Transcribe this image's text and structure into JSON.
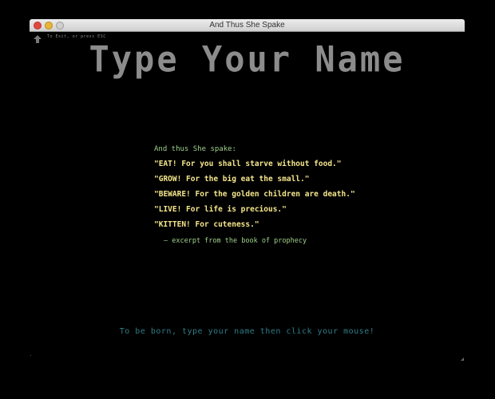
{
  "window": {
    "title": "And Thus She Spake"
  },
  "exit_hint": {
    "icon": "up-arrow-icon",
    "text": "To Exit, or press ESC"
  },
  "headline": "Type Your Name",
  "prophecy": {
    "intro": "And thus She spake:",
    "lines": [
      "\"EAT! For you shall starve without food.\"",
      "\"GROW! For the big eat the small.\"",
      "\"BEWARE! For the golden children are death.\"",
      "\"LIVE! For life is precious.\"",
      "\"KITTEN! For cuteness.\""
    ],
    "excerpt": "— excerpt from the book of prophecy"
  },
  "instruction": "To be born, type your name then click your mouse!",
  "colors": {
    "headline": "#8c8c8c",
    "intro": "#9fd18b",
    "quotes": "#f4e68c",
    "instruction": "#2f7c87",
    "background": "#000000"
  }
}
